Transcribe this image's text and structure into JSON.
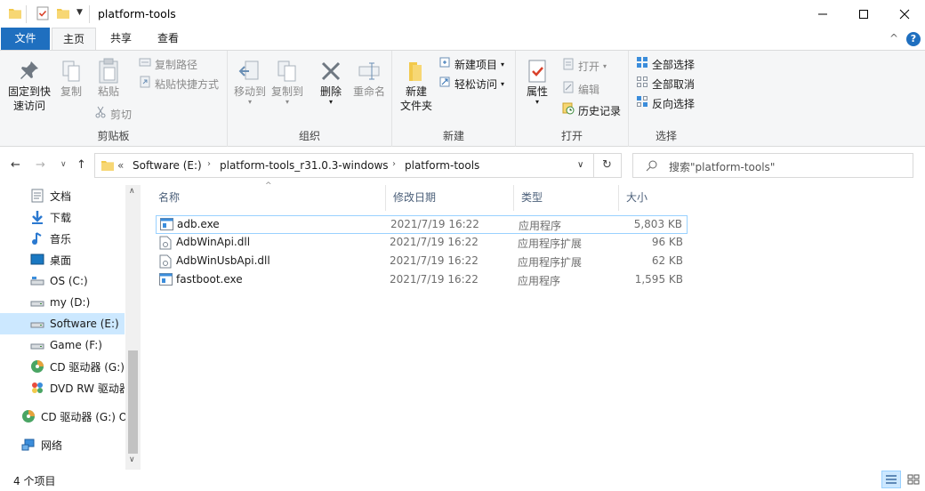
{
  "window": {
    "title": "platform-tools",
    "minimize": "—",
    "maximize": "☐",
    "close": "✕"
  },
  "tabs": [
    {
      "label": "文件"
    },
    {
      "label": "主页"
    },
    {
      "label": "共享"
    },
    {
      "label": "查看"
    }
  ],
  "ribbon": {
    "clipboard": {
      "label": "剪贴板",
      "pin": "固定到快\n速访问",
      "pin1": "固定到快",
      "pin2": "速访问",
      "copy": "复制",
      "paste": "粘贴",
      "copy_path": "复制路径",
      "paste_shortcut": "粘贴快捷方式",
      "cut": "剪切"
    },
    "organize": {
      "label": "组织",
      "move_to": "移动到",
      "copy_to": "复制到",
      "delete": "删除",
      "rename": "重命名"
    },
    "new": {
      "label": "新建",
      "new_folder1": "新建",
      "new_folder2": "文件夹",
      "new_item": "新建项目",
      "easy_access": "轻松访问"
    },
    "open": {
      "label": "打开",
      "properties": "属性",
      "open": "打开",
      "edit": "编辑",
      "history": "历史记录"
    },
    "select": {
      "label": "选择",
      "select_all": "全部选择",
      "select_none": "全部取消",
      "invert": "反向选择"
    }
  },
  "address": {
    "prefix": "«",
    "crumbs": [
      "Software (E:)",
      "platform-tools_r31.0.3-windows",
      "platform-tools"
    ],
    "search_placeholder": "搜索\"platform-tools\""
  },
  "nav": [
    {
      "label": "文档",
      "icon": "document-icon"
    },
    {
      "label": "下载",
      "icon": "download-icon"
    },
    {
      "label": "音乐",
      "icon": "music-icon"
    },
    {
      "label": "桌面",
      "icon": "desktop-icon"
    },
    {
      "label": "OS (C:)",
      "icon": "drive-icon"
    },
    {
      "label": "my (D:)",
      "icon": "drive-icon"
    },
    {
      "label": "Software (E:)",
      "icon": "drive-icon"
    },
    {
      "label": "Game (F:)",
      "icon": "drive-icon"
    },
    {
      "label": "CD 驱动器 (G:) O",
      "icon": "cd-icon"
    },
    {
      "label": "DVD RW 驱动器",
      "icon": "dvd-icon"
    },
    {
      "label": "CD 驱动器 (G:) O",
      "icon": "cd-icon"
    },
    {
      "label": "网络",
      "icon": "network-icon"
    }
  ],
  "columns": {
    "name": "名称",
    "date": "修改日期",
    "type": "类型",
    "size": "大小"
  },
  "files": [
    {
      "name": "adb.exe",
      "date": "2021/7/19 16:22",
      "type": "应用程序",
      "size": "5,803 KB"
    },
    {
      "name": "AdbWinApi.dll",
      "date": "2021/7/19 16:22",
      "type": "应用程序扩展",
      "size": "96 KB"
    },
    {
      "name": "AdbWinUsbApi.dll",
      "date": "2021/7/19 16:22",
      "type": "应用程序扩展",
      "size": "62 KB"
    },
    {
      "name": "fastboot.exe",
      "date": "2021/7/19 16:22",
      "type": "应用程序",
      "size": "1,595 KB"
    }
  ],
  "status": {
    "count": "4 个项目"
  },
  "colors": {
    "accent": "#1f6fbf",
    "selection": "#cce8ff",
    "selection_border": "#99d1ff"
  }
}
